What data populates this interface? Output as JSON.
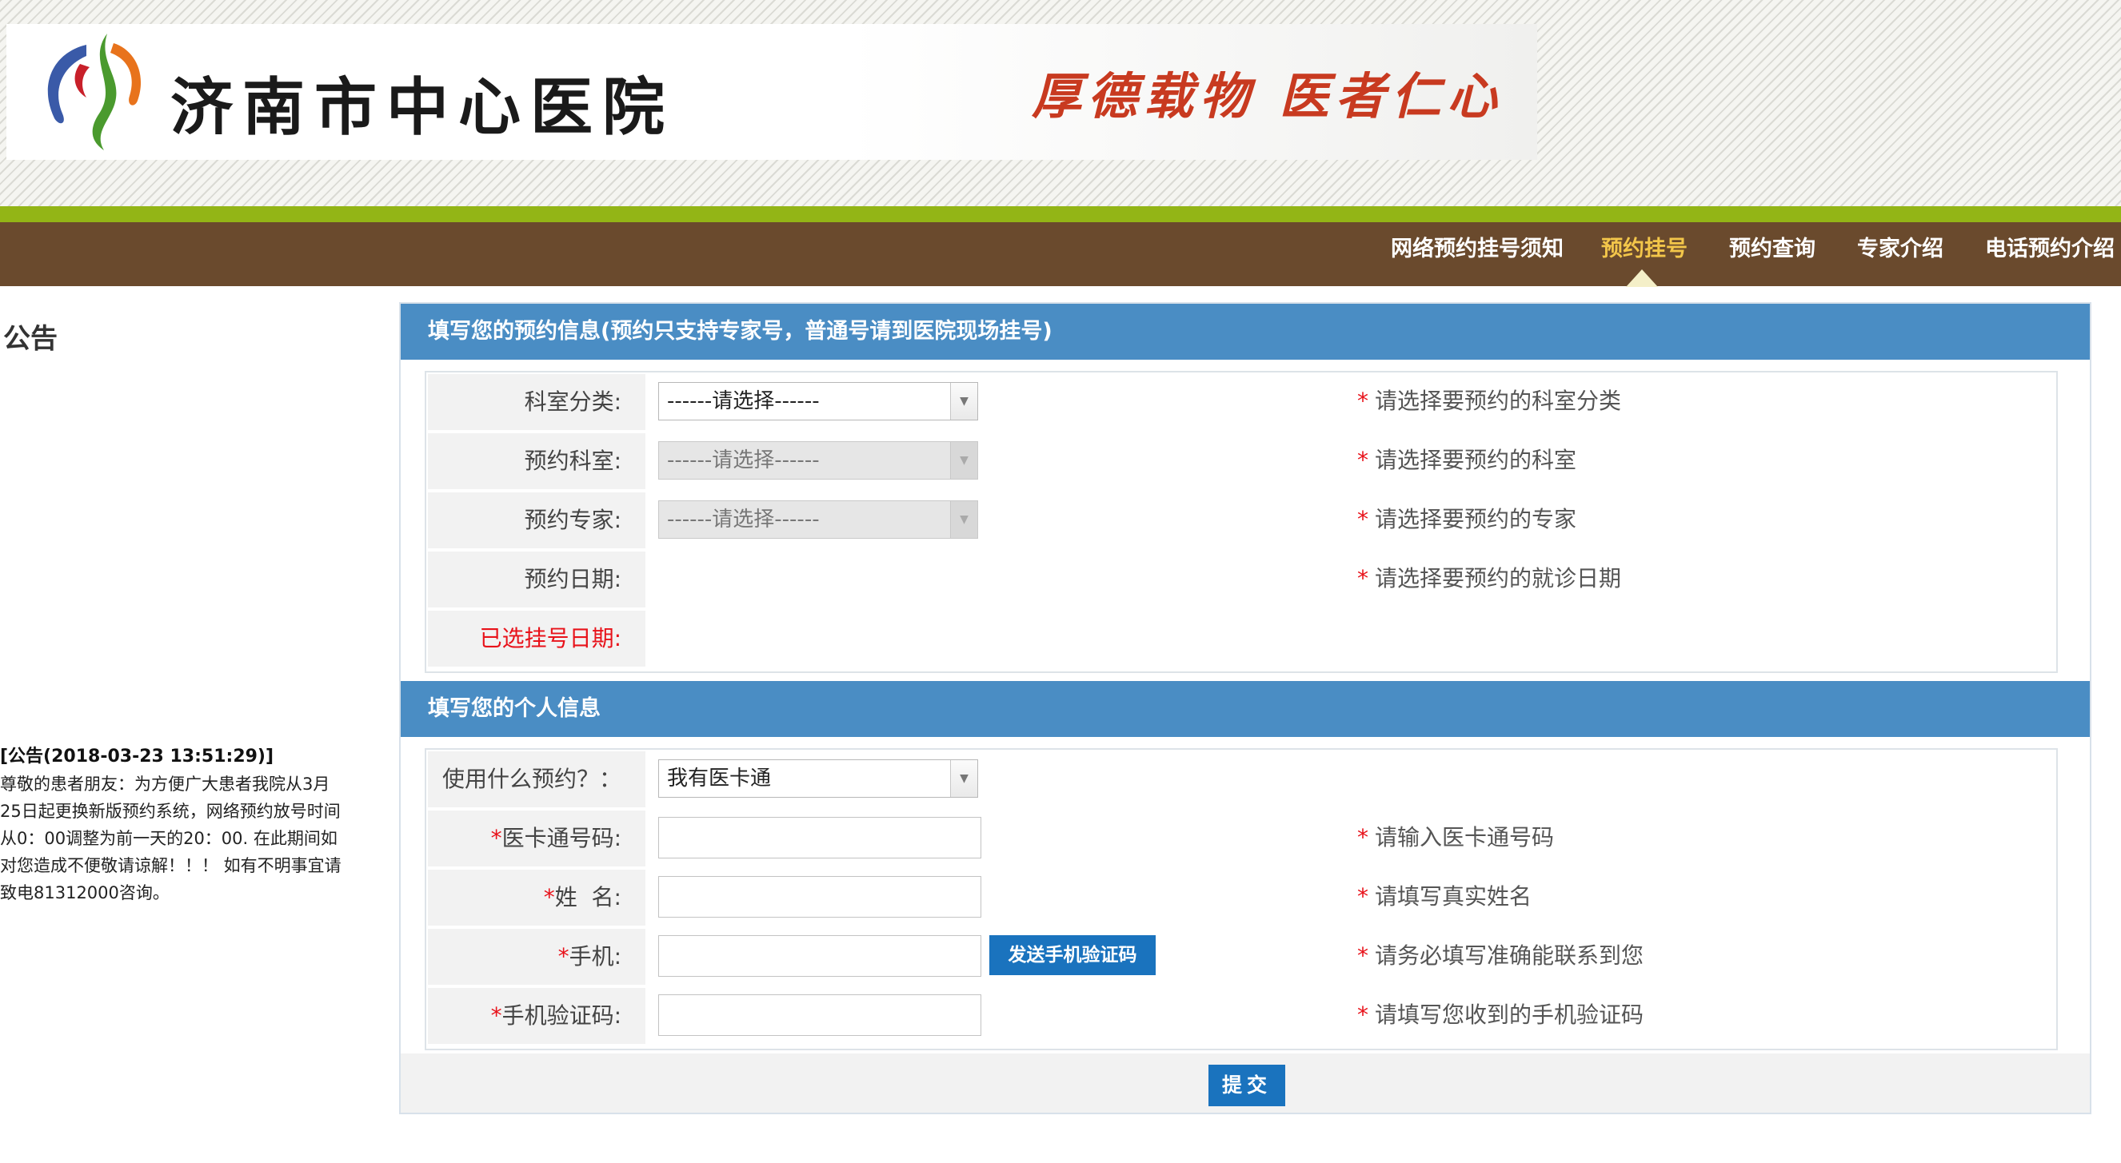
{
  "header": {
    "hospital_name": "济南市中心医院",
    "slogan": "厚德载物 医者仁心"
  },
  "nav": {
    "items": [
      {
        "label": "网络预约挂号须知"
      },
      {
        "label": "预约挂号"
      },
      {
        "label": "预约查询"
      },
      {
        "label": "专家介绍"
      },
      {
        "label": "电话预约介绍"
      }
    ],
    "active": "预约挂号"
  },
  "sidebar": {
    "title": "公告",
    "notice_title": "[公告(2018-03-23 13:51:29)]",
    "notice_lines": [
      "尊敬的患者朋友：为方便广大患者我院从3月",
      "25日起更换新版预约系统，网络预约放号时间",
      "从0：00调整为前一天的20：00. 在此期间如",
      "对您造成不便敬请谅解！！！ 如有不明事宜请",
      "致电81312000咨询。"
    ]
  },
  "appointment": {
    "heading": "填写您的预约信息(预约只支持专家号，普通号请到医院现场挂号)",
    "department_category": {
      "label": "科室分类:",
      "value": "------请选择------",
      "hint": "请选择要预约的科室分类"
    },
    "department": {
      "label": "预约科室:",
      "value": "------请选择------",
      "hint": "请选择要预约的科室"
    },
    "expert": {
      "label": "预约专家:",
      "value": "------请选择------",
      "hint": "请选择要预约的专家"
    },
    "date": {
      "label": "预约日期:",
      "hint": "请选择要预约的就诊日期"
    },
    "selected_date": {
      "label": "已选挂号日期:"
    }
  },
  "personal": {
    "heading": "填写您的个人信息",
    "method": {
      "label": "使用什么预约？：",
      "value": "我有医卡通"
    },
    "card_number": {
      "label": "医卡通号码:",
      "hint": "请输入医卡通号码"
    },
    "name": {
      "label": "姓  名:",
      "hint": "请填写真实姓名"
    },
    "phone": {
      "label": "手机:",
      "hint": "请务必填写准确能联系到您"
    },
    "sms_button": "发送手机验证码",
    "sms_code": {
      "label": "手机验证码:",
      "hint": "请填写您收到的手机验证码"
    }
  },
  "hint_star": "*",
  "submit_label": "提交",
  "colors": {
    "nav_bg": "#6a4a2d",
    "accent_green": "#93b516",
    "section_blue": "#4a8dc4",
    "button_blue": "#1a73be",
    "required_red": "#e8121a",
    "nav_active": "#f3c64a"
  }
}
